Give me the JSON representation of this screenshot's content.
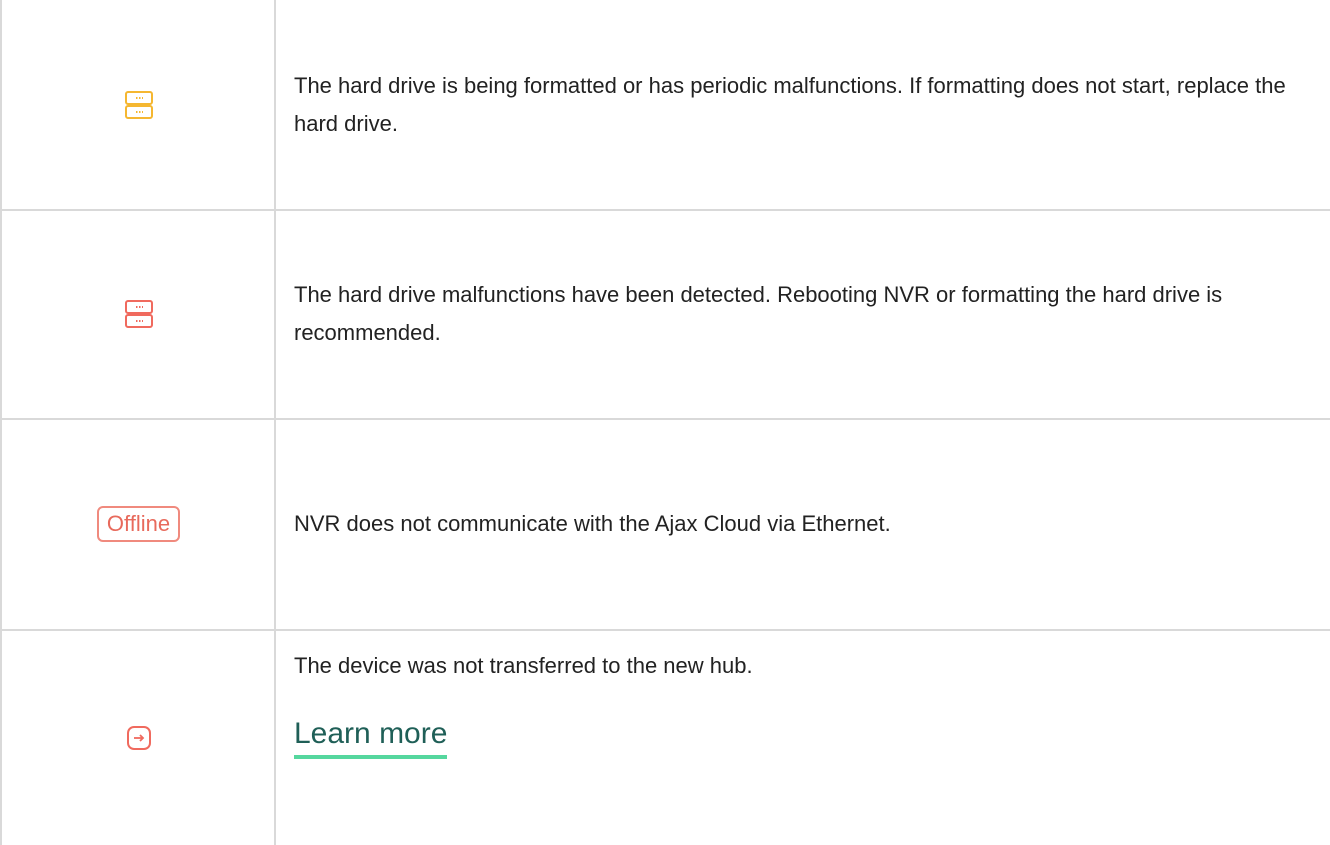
{
  "rows": [
    {
      "icon": "hard-drive-icon",
      "icon_color": "#f5b731",
      "text": "The hard drive is being formatted or has periodic malfunctions. If formatting does not start, replace the hard drive."
    },
    {
      "icon": "hard-drive-icon",
      "icon_color": "#f06a5e",
      "text": "The hard drive malfunctions have been detected. Rebooting NVR or formatting the hard drive is recommended."
    },
    {
      "badge": "Offline",
      "badge_color": "#e86a5c",
      "text": "NVR does not communicate with the Ajax Cloud via Ethernet."
    },
    {
      "icon": "transfer-arrow-icon",
      "icon_color": "#f06a5e",
      "text": "The device was not transferred to the new hub.",
      "link": "Learn more"
    }
  ],
  "colors": {
    "border": "#d9d9d9",
    "link_underline": "#55d79e",
    "link_text": "#1f5f57"
  }
}
